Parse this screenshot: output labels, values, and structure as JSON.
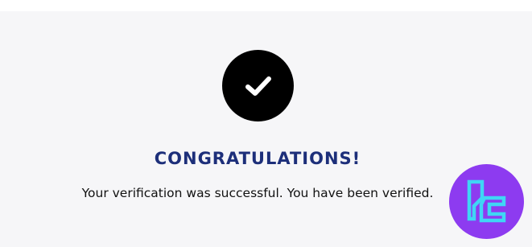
{
  "page": {
    "headline": "CONGRATULATIONS!",
    "message": "Your verification was successful. You have been verified."
  },
  "icons": {
    "status": "checkmark-icon",
    "brand": "tc-logo"
  },
  "colors": {
    "background": "#f6f6f8",
    "headline": "#1d2f7a",
    "circle": "#000000",
    "badge_bg": "#8d3bf0",
    "badge_logo": "#3fd6f5"
  }
}
